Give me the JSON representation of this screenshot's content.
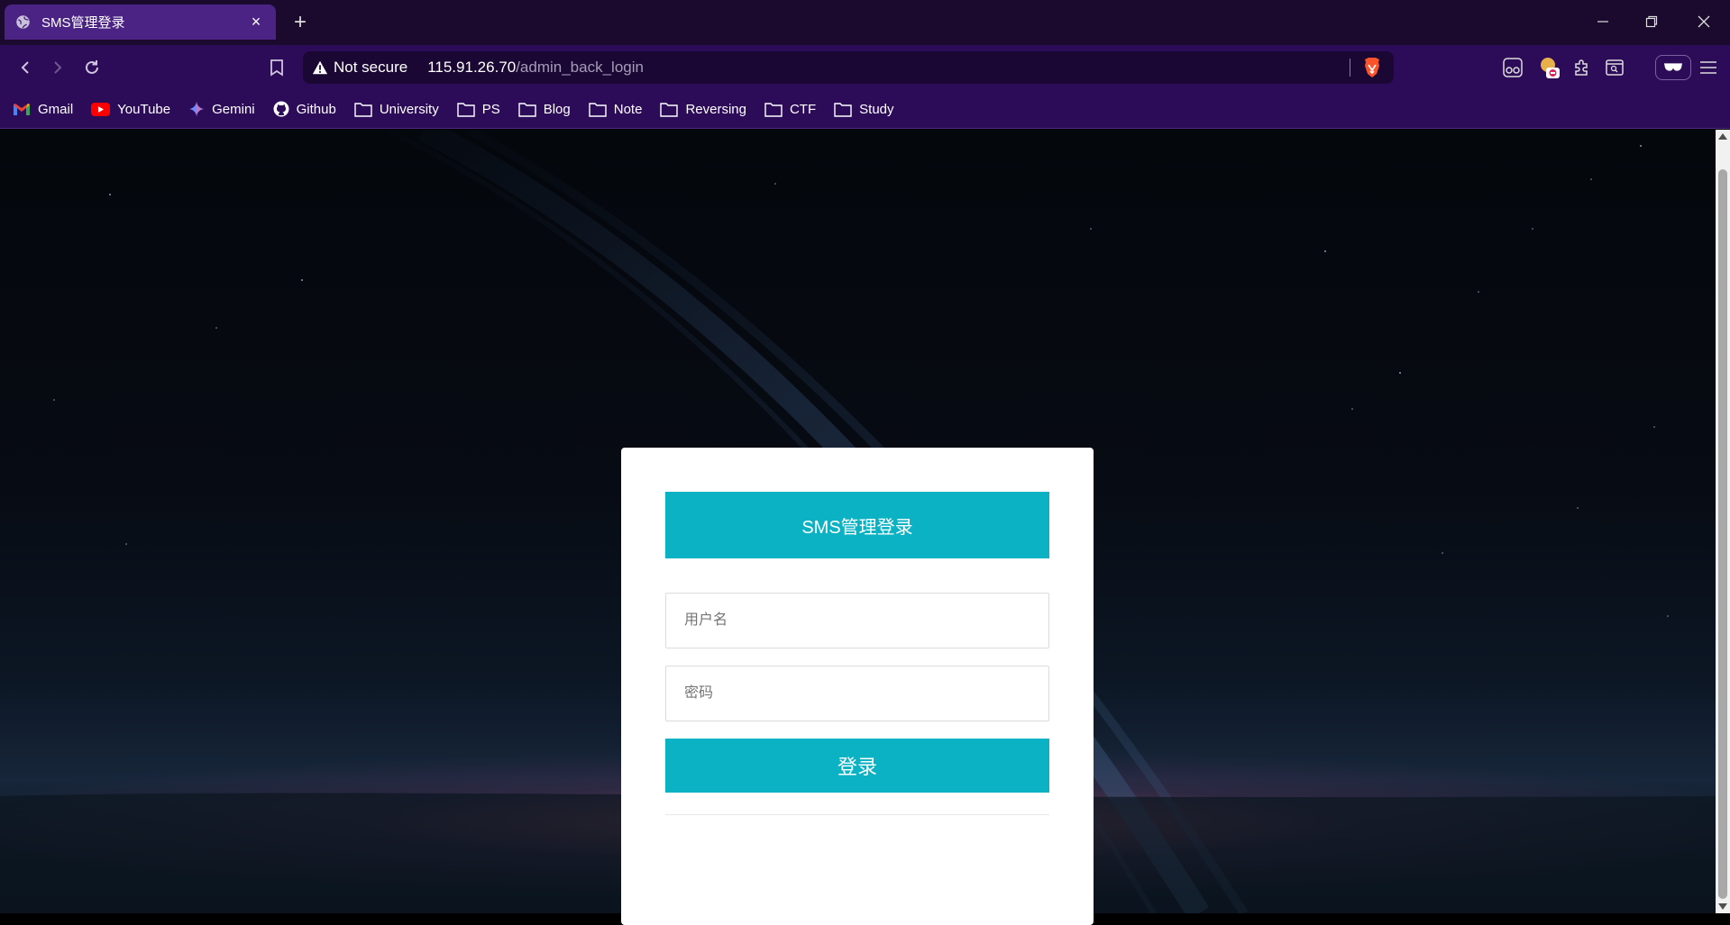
{
  "tab": {
    "title": "SMS管理登录",
    "close": "×"
  },
  "newtab": "+",
  "omnibox": {
    "security_label": "Not secure",
    "host": "115.91.26.70",
    "path": "/admin_back_login"
  },
  "bookmarks": [
    {
      "label": "Gmail",
      "icon": "gmail-icon"
    },
    {
      "label": "YouTube",
      "icon": "youtube-icon"
    },
    {
      "label": "Gemini",
      "icon": "gemini-icon"
    },
    {
      "label": "Github",
      "icon": "github-icon"
    },
    {
      "label": "University",
      "icon": "folder-icon"
    },
    {
      "label": "PS",
      "icon": "folder-icon"
    },
    {
      "label": "Blog",
      "icon": "folder-icon"
    },
    {
      "label": "Note",
      "icon": "folder-icon"
    },
    {
      "label": "Reversing",
      "icon": "folder-icon"
    },
    {
      "label": "CTF",
      "icon": "folder-icon"
    },
    {
      "label": "Study",
      "icon": "folder-icon"
    }
  ],
  "login": {
    "title": "SMS管理登录",
    "username_placeholder": "用户名",
    "username_value": "",
    "password_placeholder": "密码",
    "password_value": "",
    "submit_label": "登录"
  },
  "colors": {
    "accent": "#0bb2c4",
    "tabstrip": "#1b0a2e",
    "toolbar": "#2c0b59",
    "active_tab": "#4a2385"
  }
}
